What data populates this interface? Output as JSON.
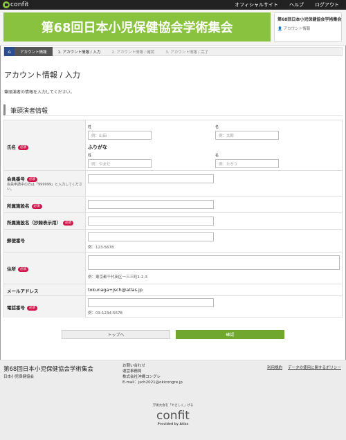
{
  "topbar": {
    "logo": "confit",
    "nav": [
      "オフィシャルサイト",
      "ヘルプ",
      "ログアウト"
    ]
  },
  "header": {
    "banner_title": "第68回日本小児保健協会学術集会",
    "side_title": "第68回日本小児保健協会学術集会",
    "side_sub": "アカウント情報"
  },
  "breadcrumb": {
    "active": "アカウント情報",
    "steps": [
      "1. アカウント情報 / 入力",
      "2. アカウント情報 / 確認",
      "3. アカウント情報 / 完了"
    ]
  },
  "page": {
    "title": "アカウント情報 / 入力",
    "intro": "筆頭演者の情報を入力してください。",
    "section": "筆頭演者情報"
  },
  "form": {
    "required_badge": "必須",
    "name": {
      "label": "氏名",
      "sei": "姓",
      "mei": "名",
      "sei_placeholder": "例：山田",
      "mei_placeholder": "例：太郎",
      "furigana": "ふりがな",
      "sei_kana": "姓",
      "mei_kana": "名",
      "sei_kana_placeholder": "例：やまだ",
      "mei_kana_placeholder": "例：たろう"
    },
    "member_no": {
      "label": "会員番号",
      "note": "会員申請中の方は「999999」と入力してください。"
    },
    "affiliation": {
      "label": "所属施設名"
    },
    "affiliation_abstract": {
      "label": "所属施設名（抄録表示用）"
    },
    "postal": {
      "label": "郵便番号",
      "hint": "例：123-5678"
    },
    "address": {
      "label": "住所",
      "hint": "例：東京都千代田区一三三町1-2-3"
    },
    "email": {
      "label": "メールアドレス",
      "value": "tokunaga+jsch@atlas.jp"
    },
    "phone": {
      "label": "電話番号",
      "hint": "例：03-1234-5678"
    }
  },
  "buttons": {
    "back": "トップへ",
    "confirm": "確認"
  },
  "footer": {
    "title": "第68回日本小児保健協会学術集会",
    "sub": "日本小児保健協会",
    "contact": [
      "お問い合わせ",
      "運営事務局",
      "株式会社沖縄コングレ",
      "E-mail：jsch2021@okicongre.jp"
    ],
    "links": [
      "利用規約",
      "データの使用に関するポリシー"
    ],
    "logo_tagline": "学術大会を「やさしく」げる",
    "logo_brand": "confit",
    "logo_by": "Provided by Atlas"
  },
  "colors": {
    "banner": "#89c23f",
    "required": "#d0154a",
    "confirm_button": "#6fa72f",
    "home": "#2b4f8a"
  }
}
